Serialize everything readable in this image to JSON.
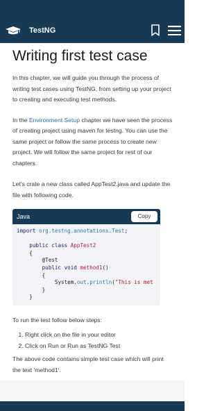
{
  "header": {
    "brand": "TestNG",
    "logo_icon": "graduation-cap-icon",
    "bookmark_icon": "bookmark-icon",
    "menu_icon": "hamburger-menu-icon"
  },
  "article": {
    "title": "Writing first test case",
    "para1": "In this chapter, we will guide you through the process of writing test cases using TestNG, from setting up your project to creating and executing test methods.",
    "para2_before": "In the ",
    "para2_link": "Environment Setup",
    "para2_after": " chapter we have seen the process of creating project using maven for testng. You can use the same project or follow the same process to create new project. We will follow the same project for rest of our chapters.",
    "para3": "Let's crate a new class called AppTest2.java and update the file with following code.",
    "code": {
      "language": "Java",
      "copy_label": "Copy",
      "import_kw": "import",
      "import_pkg": "org.testng.annotations.Test",
      "class_mods": "public class",
      "class_name": "AppTest2",
      "annotation": "@Test",
      "method_mods": "public void",
      "method_name": "method1",
      "print_prefix": "System.",
      "print_out": "out",
      "print_fn": "println",
      "print_str": "\"This is met"
    },
    "para4": "To run the test follow below steps:",
    "steps": [
      "Right click on the file in your editor",
      "Click on Run or Run as TestNG Test"
    ],
    "para5": "The above code contains simple test case which will print the text 'method1'."
  },
  "colors": {
    "primary": "#173a57",
    "link": "#2e6da4"
  }
}
